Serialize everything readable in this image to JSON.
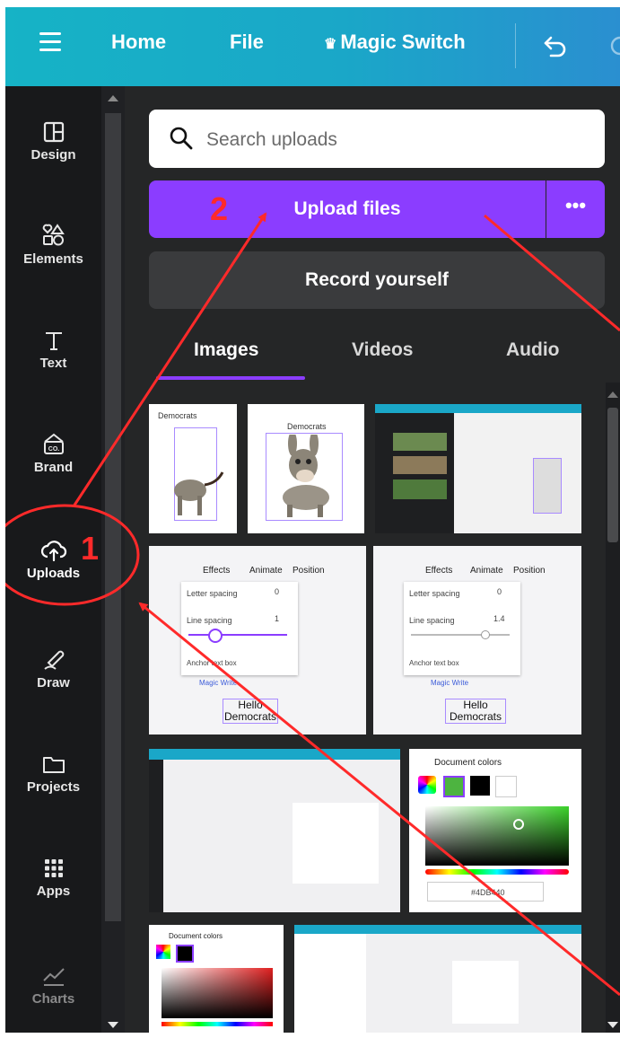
{
  "topbar": {
    "home_label": "Home",
    "file_label": "File",
    "magic_switch_label": "Magic Switch",
    "crown_glyph": "♛",
    "undo_icon": "undo-icon"
  },
  "rail": {
    "items": [
      {
        "label": "Design",
        "icon": "layout-icon"
      },
      {
        "label": "Elements",
        "icon": "shapes-icon"
      },
      {
        "label": "Text",
        "icon": "text-icon"
      },
      {
        "label": "Brand",
        "icon": "brand-icon"
      },
      {
        "label": "Uploads",
        "icon": "cloud-upload-icon"
      },
      {
        "label": "Draw",
        "icon": "pen-icon"
      },
      {
        "label": "Projects",
        "icon": "folder-icon"
      },
      {
        "label": "Apps",
        "icon": "grid-icon"
      },
      {
        "label": "Charts",
        "icon": "chart-icon"
      }
    ]
  },
  "panel": {
    "search_placeholder": "Search uploads",
    "upload_label": "Upload files",
    "more_label": "•••",
    "record_label": "Record yourself",
    "tabs": [
      "Images",
      "Videos",
      "Audio"
    ],
    "active_tab": "Images"
  },
  "thumbnails": {
    "t1_caption": "Democrats",
    "t2_caption": "Democrats",
    "t4_menu": [
      "Effects",
      "Animate",
      "Position"
    ],
    "t4_letter_spacing": "Letter spacing",
    "t4_letter_value": "0",
    "t4_line_spacing": "Line spacing",
    "t4_line_value": "1",
    "t4_anchor": "Anchor text box",
    "t4_magic": "Magic Write",
    "t4_hello": "Hello",
    "t4_democrats": "Democrats",
    "t5_menu": [
      "Effects",
      "Animate",
      "Position"
    ],
    "t5_letter_spacing": "Letter spacing",
    "t5_letter_value": "0",
    "t5_line_spacing": "Line spacing",
    "t5_line_value": "1.4",
    "t5_anchor": "Anchor text box",
    "t5_magic": "Magic Write",
    "t5_hello": "Hello",
    "t5_democrats": "Democrats",
    "t7_title": "Document colors",
    "t7_hex": "#4DB440",
    "t8_title": "Document colors"
  },
  "annotations": {
    "step1": "1",
    "step2": "2",
    "color": "#ff2a2a"
  },
  "colors": {
    "accent": "#8b3dff",
    "topbar_start": "#16b3c6",
    "topbar_end": "#2a8fd0",
    "rail_bg": "#18191b",
    "panel_bg": "#252627",
    "annotation": "#ff2a2a"
  }
}
